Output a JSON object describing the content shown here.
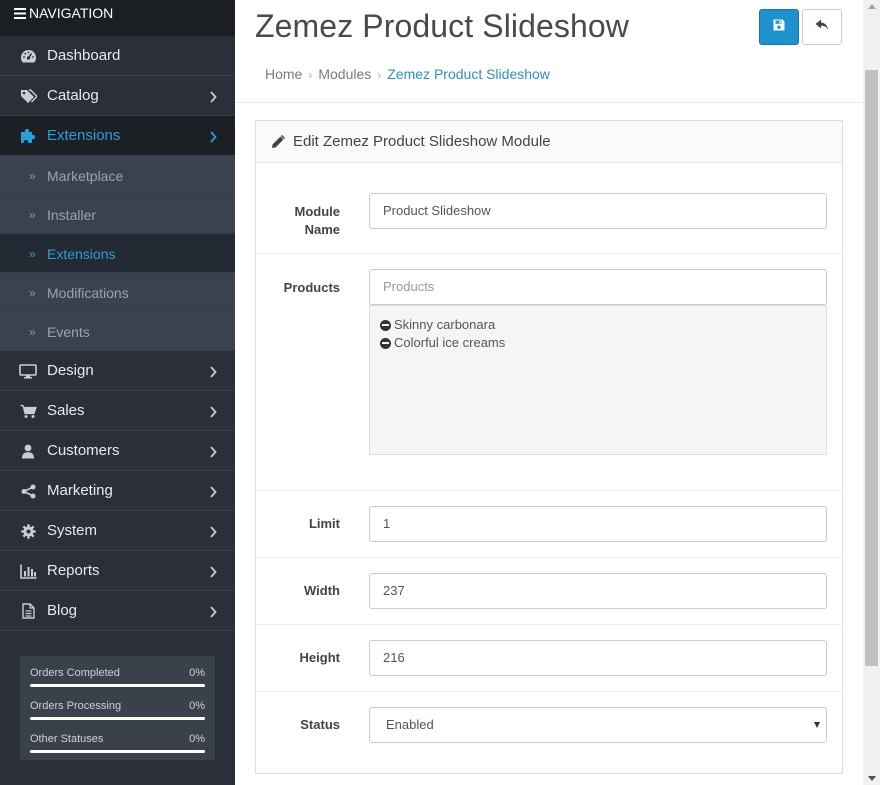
{
  "sidebar": {
    "header": "NAVIGATION",
    "items": [
      {
        "label": "Dashboard",
        "icon": "dashboard-icon"
      },
      {
        "label": "Catalog",
        "icon": "tags-icon"
      },
      {
        "label": "Extensions",
        "icon": "puzzle-icon"
      },
      {
        "label": "Design",
        "icon": "monitor-icon"
      },
      {
        "label": "Sales",
        "icon": "cart-icon"
      },
      {
        "label": "Customers",
        "icon": "user-icon"
      },
      {
        "label": "Marketing",
        "icon": "share-icon"
      },
      {
        "label": "System",
        "icon": "gear-icon"
      },
      {
        "label": "Reports",
        "icon": "bar-chart-icon"
      },
      {
        "label": "Blog",
        "icon": "file-icon"
      }
    ],
    "submenu": [
      {
        "label": "Marketplace"
      },
      {
        "label": "Installer"
      },
      {
        "label": "Extensions"
      },
      {
        "label": "Modifications"
      },
      {
        "label": "Events"
      }
    ],
    "stats": [
      {
        "label": "Orders Completed",
        "value": "0%",
        "percent": 0
      },
      {
        "label": "Orders Processing",
        "value": "0%",
        "percent": 0
      },
      {
        "label": "Other Statuses",
        "value": "0%",
        "percent": 0
      }
    ]
  },
  "header": {
    "title": "Zemez Product Slideshow",
    "breadcrumb": [
      "Home",
      "Modules",
      "Zemez Product Slideshow"
    ]
  },
  "panel": {
    "title": "Edit Zemez Product Slideshow Module"
  },
  "form": {
    "module_name": {
      "label_line1": "Module",
      "label_line2": "Name",
      "value": "Product Slideshow"
    },
    "products": {
      "label": "Products",
      "placeholder": "Products",
      "items": [
        "Skinny carbonara",
        "Colorful ice creams"
      ]
    },
    "limit": {
      "label": "Limit",
      "value": "1"
    },
    "width": {
      "label": "Width",
      "value": "237"
    },
    "height": {
      "label": "Height",
      "value": "216"
    },
    "status": {
      "label": "Status",
      "value": "Enabled"
    }
  },
  "colors": {
    "sidebar_bg": "#2b3038",
    "accent": "#2a9fd6",
    "primary_button": "#1e91cf"
  }
}
